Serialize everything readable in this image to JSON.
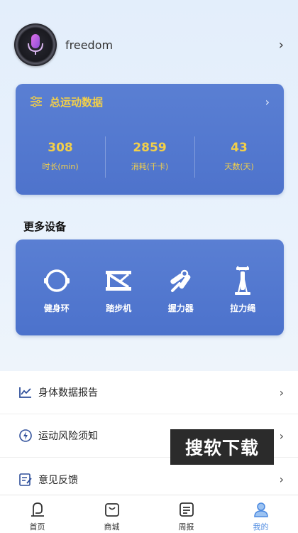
{
  "profile": {
    "username": "freedom",
    "chevron": "›"
  },
  "stats": {
    "title": "总运动数据",
    "chevron": "›",
    "items": [
      {
        "value": "308",
        "label": "时长(min)"
      },
      {
        "value": "2859",
        "label": "消耗(千卡)"
      },
      {
        "value": "43",
        "label": "天数(天)"
      }
    ]
  },
  "devices": {
    "section_title": "更多设备",
    "items": [
      {
        "label": "健身环",
        "icon": "fitness-ring-icon"
      },
      {
        "label": "踏步机",
        "icon": "stepper-icon"
      },
      {
        "label": "握力器",
        "icon": "hand-gripper-icon"
      },
      {
        "label": "拉力绳",
        "icon": "resistance-band-icon"
      }
    ]
  },
  "menu": {
    "items": [
      {
        "label": "身体数据报告",
        "icon": "chart-icon"
      },
      {
        "label": "运动风险须知",
        "icon": "risk-icon"
      },
      {
        "label": "意见反馈",
        "icon": "feedback-icon"
      }
    ],
    "chevron": "›"
  },
  "watermark": "搜软下载",
  "tabbar": {
    "items": [
      {
        "label": "首页",
        "icon": "home-icon"
      },
      {
        "label": "商城",
        "icon": "shop-bag-icon"
      },
      {
        "label": "周报",
        "icon": "report-icon"
      },
      {
        "label": "我的",
        "icon": "profile-icon",
        "active": true
      }
    ]
  },
  "colors": {
    "card_blue": "#5279cf",
    "accent_yellow": "#f2cf4a",
    "active_tab": "#4d8ae0"
  }
}
